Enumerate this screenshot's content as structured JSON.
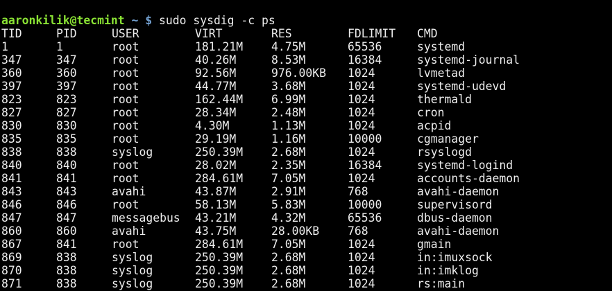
{
  "prompt": {
    "user_host": "aaronkilik@tecmint",
    "path": "~",
    "symbol": "$",
    "command": "sudo sysdig -c ps"
  },
  "colors": {
    "user_host": "#8ae234",
    "path": "#729fcf",
    "background": "#000000",
    "text": "#ececec"
  },
  "headers": [
    "TID",
    "PID",
    "USER",
    "VIRT",
    "RES",
    "FDLIMIT",
    "CMD"
  ],
  "rows": [
    [
      "1",
      "1",
      "root",
      "181.21M",
      "4.75M",
      "65536",
      "systemd"
    ],
    [
      "347",
      "347",
      "root",
      "40.26M",
      "8.53M",
      "16384",
      "systemd-journal"
    ],
    [
      "360",
      "360",
      "root",
      "92.56M",
      "976.00KB",
      "1024",
      "lvmetad"
    ],
    [
      "397",
      "397",
      "root",
      "44.77M",
      "3.68M",
      "1024",
      "systemd-udevd"
    ],
    [
      "823",
      "823",
      "root",
      "162.44M",
      "6.99M",
      "1024",
      "thermald"
    ],
    [
      "827",
      "827",
      "root",
      "28.34M",
      "2.48M",
      "1024",
      "cron"
    ],
    [
      "830",
      "830",
      "root",
      "4.30M",
      "1.13M",
      "1024",
      "acpid"
    ],
    [
      "835",
      "835",
      "root",
      "29.19M",
      "1.16M",
      "10000",
      "cgmanager"
    ],
    [
      "838",
      "838",
      "syslog",
      "250.39M",
      "2.68M",
      "1024",
      "rsyslogd"
    ],
    [
      "840",
      "840",
      "root",
      "28.02M",
      "2.35M",
      "16384",
      "systemd-logind"
    ],
    [
      "841",
      "841",
      "root",
      "284.61M",
      "7.05M",
      "1024",
      "accounts-daemon"
    ],
    [
      "843",
      "843",
      "avahi",
      "43.87M",
      "2.91M",
      "768",
      "avahi-daemon"
    ],
    [
      "846",
      "846",
      "root",
      "58.13M",
      "5.83M",
      "10000",
      "supervisord"
    ],
    [
      "847",
      "847",
      "messagebus",
      "43.21M",
      "4.32M",
      "65536",
      "dbus-daemon"
    ],
    [
      "860",
      "860",
      "avahi",
      "43.75M",
      "28.00KB",
      "768",
      "avahi-daemon"
    ],
    [
      "867",
      "841",
      "root",
      "284.61M",
      "7.05M",
      "1024",
      "gmain"
    ],
    [
      "869",
      "838",
      "syslog",
      "250.39M",
      "2.68M",
      "1024",
      "in:imuxsock"
    ],
    [
      "870",
      "838",
      "syslog",
      "250.39M",
      "2.68M",
      "1024",
      "in:imklog"
    ],
    [
      "871",
      "838",
      "syslog",
      "250.39M",
      "2.68M",
      "1024",
      "rs:main"
    ]
  ]
}
